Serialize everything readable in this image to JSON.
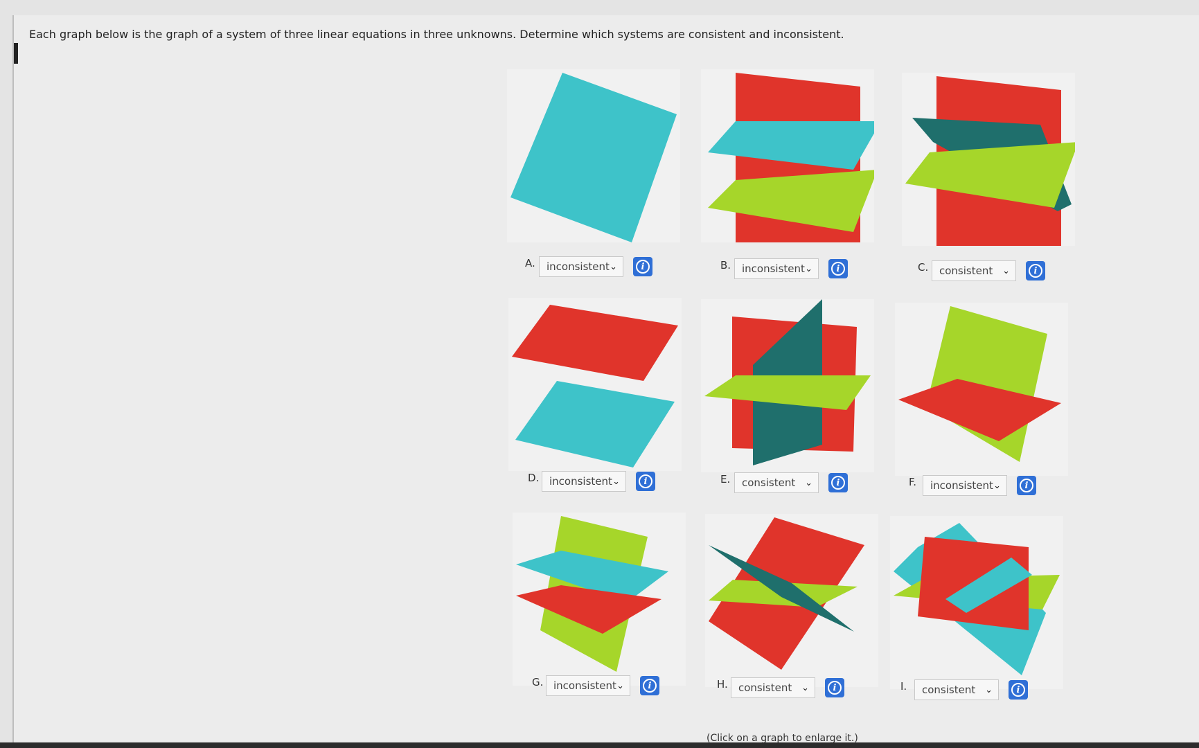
{
  "question": "Each graph below is the graph of a system of three linear equations in three unknowns. Determine which systems are consistent and inconsistent.",
  "caption": "(Click on a graph to enlarge it.)",
  "colors": {
    "red": "#e0342b",
    "cyan": "#3ec3c9",
    "lime": "#a6d62a",
    "teal": "#1f6f6c",
    "info": "#2f6fd6"
  },
  "icons": {
    "dropdown": "chevron-down-icon",
    "info": "info-icon"
  },
  "graphs": [
    {
      "letter": "A.",
      "answer": "inconsistent",
      "info": "i"
    },
    {
      "letter": "B.",
      "answer": "inconsistent",
      "info": "i"
    },
    {
      "letter": "C.",
      "answer": "consistent",
      "info": "i"
    },
    {
      "letter": "D.",
      "answer": "inconsistent",
      "info": "i"
    },
    {
      "letter": "E.",
      "answer": "consistent",
      "info": "i"
    },
    {
      "letter": "F.",
      "answer": "inconsistent",
      "info": "i"
    },
    {
      "letter": "G.",
      "answer": "inconsistent",
      "info": "i"
    },
    {
      "letter": "H.",
      "answer": "consistent",
      "info": "i"
    },
    {
      "letter": "I.",
      "answer": "consistent",
      "info": "i"
    }
  ]
}
